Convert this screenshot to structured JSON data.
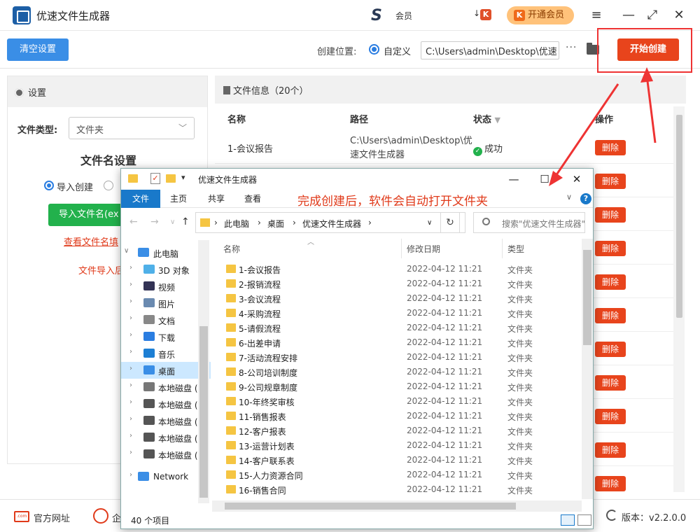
{
  "app": {
    "title": "优速文件生成器",
    "user_label": "会员",
    "vip_label": "开通会员",
    "vip_k": "K",
    "sort_k": "K"
  },
  "toolbar": {
    "clear_label": "清空设置",
    "location_label": "创建位置:",
    "custom_label": "自定义",
    "path_value": "C:\\Users\\admin\\Desktop\\优速",
    "more_label": "···",
    "start_label": "开始创建"
  },
  "left": {
    "header": "设置",
    "file_type_label": "文件类型:",
    "file_type_value": "文件夹",
    "name_setting_title": "文件名设置",
    "radio_import": "导入创建",
    "import_button": "导入文件名(ex",
    "view_link": "查看文件名填",
    "import_hint": "文件导入后"
  },
  "right": {
    "header": "文件信息（20个）",
    "columns": [
      "名称",
      "路径",
      "状态",
      "操作"
    ],
    "first_row": {
      "name": "1-会议报告",
      "path": "C:\\Users\\admin\\Desktop\\优速文件生成器",
      "status": "成功"
    },
    "delete_label": "删除"
  },
  "bottom": {
    "website": "官方网址",
    "web_icon_text": ".com",
    "qq_label": "企",
    "version": "版本：v2.2.0.0"
  },
  "explorer": {
    "title": "优速文件生成器",
    "tabs": [
      "文件",
      "主页",
      "共享",
      "查看"
    ],
    "annotation": "完成创建后，软件会自动打开文件夹",
    "breadcrumb": [
      "此电脑",
      "桌面",
      "优速文件生成器"
    ],
    "search_placeholder": "搜索\"优速文件生成器\"",
    "nav": [
      {
        "label": "此电脑",
        "chev": "∨"
      },
      {
        "label": "3D 对象",
        "chev": "›"
      },
      {
        "label": "视频",
        "chev": "›"
      },
      {
        "label": "图片",
        "chev": "›"
      },
      {
        "label": "文档",
        "chev": "›"
      },
      {
        "label": "下载",
        "chev": "›"
      },
      {
        "label": "音乐",
        "chev": "›"
      },
      {
        "label": "桌面",
        "chev": "›"
      },
      {
        "label": "本地磁盘 (",
        "chev": "›"
      },
      {
        "label": "本地磁盘 (",
        "chev": "›"
      },
      {
        "label": "本地磁盘 (",
        "chev": "›"
      },
      {
        "label": "本地磁盘 (",
        "chev": "›"
      },
      {
        "label": "本地磁盘 (",
        "chev": "›"
      },
      {
        "label": "Network",
        "chev": "›"
      }
    ],
    "columns": [
      "名称",
      "修改日期",
      "类型"
    ],
    "files": [
      {
        "name": "1-会议报告",
        "date": "2022-04-12 11:21",
        "type": "文件夹"
      },
      {
        "name": "2-报销流程",
        "date": "2022-04-12 11:21",
        "type": "文件夹"
      },
      {
        "name": "3-会议流程",
        "date": "2022-04-12 11:21",
        "type": "文件夹"
      },
      {
        "name": "4-采购流程",
        "date": "2022-04-12 11:21",
        "type": "文件夹"
      },
      {
        "name": "5-请假流程",
        "date": "2022-04-12 11:21",
        "type": "文件夹"
      },
      {
        "name": "6-出差申请",
        "date": "2022-04-12 11:21",
        "type": "文件夹"
      },
      {
        "name": "7-活动流程安排",
        "date": "2022-04-12 11:21",
        "type": "文件夹"
      },
      {
        "name": "8-公司培训制度",
        "date": "2022-04-12 11:21",
        "type": "文件夹"
      },
      {
        "name": "9-公司规章制度",
        "date": "2022-04-12 11:21",
        "type": "文件夹"
      },
      {
        "name": "10-年终奖审核",
        "date": "2022-04-12 11:21",
        "type": "文件夹"
      },
      {
        "name": "11-销售报表",
        "date": "2022-04-12 11:21",
        "type": "文件夹"
      },
      {
        "name": "12-客户报表",
        "date": "2022-04-12 11:21",
        "type": "文件夹"
      },
      {
        "name": "13-运营计划表",
        "date": "2022-04-12 11:21",
        "type": "文件夹"
      },
      {
        "name": "14-客户联系表",
        "date": "2022-04-12 11:21",
        "type": "文件夹"
      },
      {
        "name": "15-人力资源合同",
        "date": "2022-04-12 11:21",
        "type": "文件夹"
      },
      {
        "name": "16-销售合同",
        "date": "2022-04-12 11:21",
        "type": "文件夹"
      }
    ],
    "status": "40 个项目"
  }
}
